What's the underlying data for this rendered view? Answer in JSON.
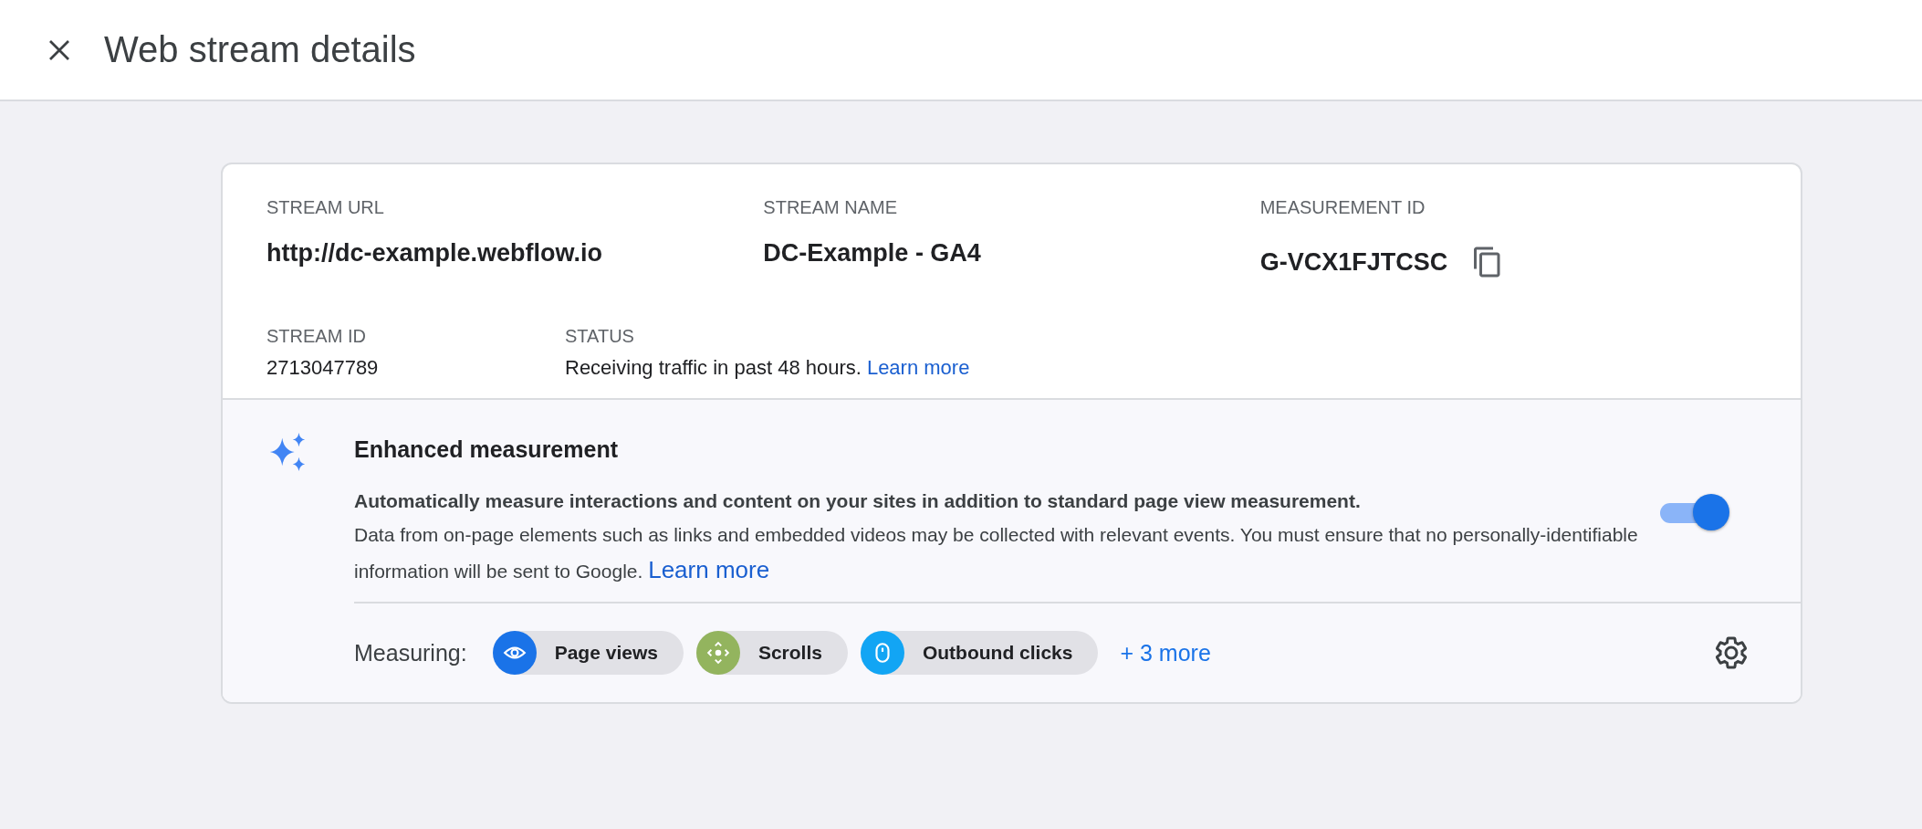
{
  "header": {
    "title": "Web stream details"
  },
  "details": {
    "row_1": [
      {
        "kind": "plain",
        "label": "STREAM URL",
        "value": "http://dc-example.webflow.io"
      },
      {
        "kind": "plain",
        "label": "STREAM NAME",
        "value": "DC-Example - GA4"
      },
      {
        "kind": "copy",
        "label": "MEASUREMENT ID",
        "value": "G-VCX1FJTCSC"
      }
    ],
    "stream_id": {
      "label": "STREAM ID",
      "value": "2713047789"
    },
    "status": {
      "label": "STATUS",
      "text": "Receiving traffic in past 48 hours.",
      "link": "Learn more"
    }
  },
  "enhanced": {
    "title": "Enhanced measurement",
    "summary": "Automatically measure interactions and content on your sites in addition to standard page view measurement.",
    "description": "Data from on-page elements such as links and embedded videos may be collected with relevant events. You must ensure that no personally-identifiable information will be sent to Google.",
    "link": "Learn more",
    "on": true,
    "measuring_label": "Measuring:",
    "chips": [
      {
        "kind": "eye",
        "label": "Page views",
        "color": "#1a73e8"
      },
      {
        "kind": "scroll",
        "label": "Scrolls",
        "color": "#93b45e"
      },
      {
        "kind": "mouse",
        "label": "Outbound clicks",
        "color": "#12a5f4"
      }
    ],
    "more": "+ 3 more"
  }
}
